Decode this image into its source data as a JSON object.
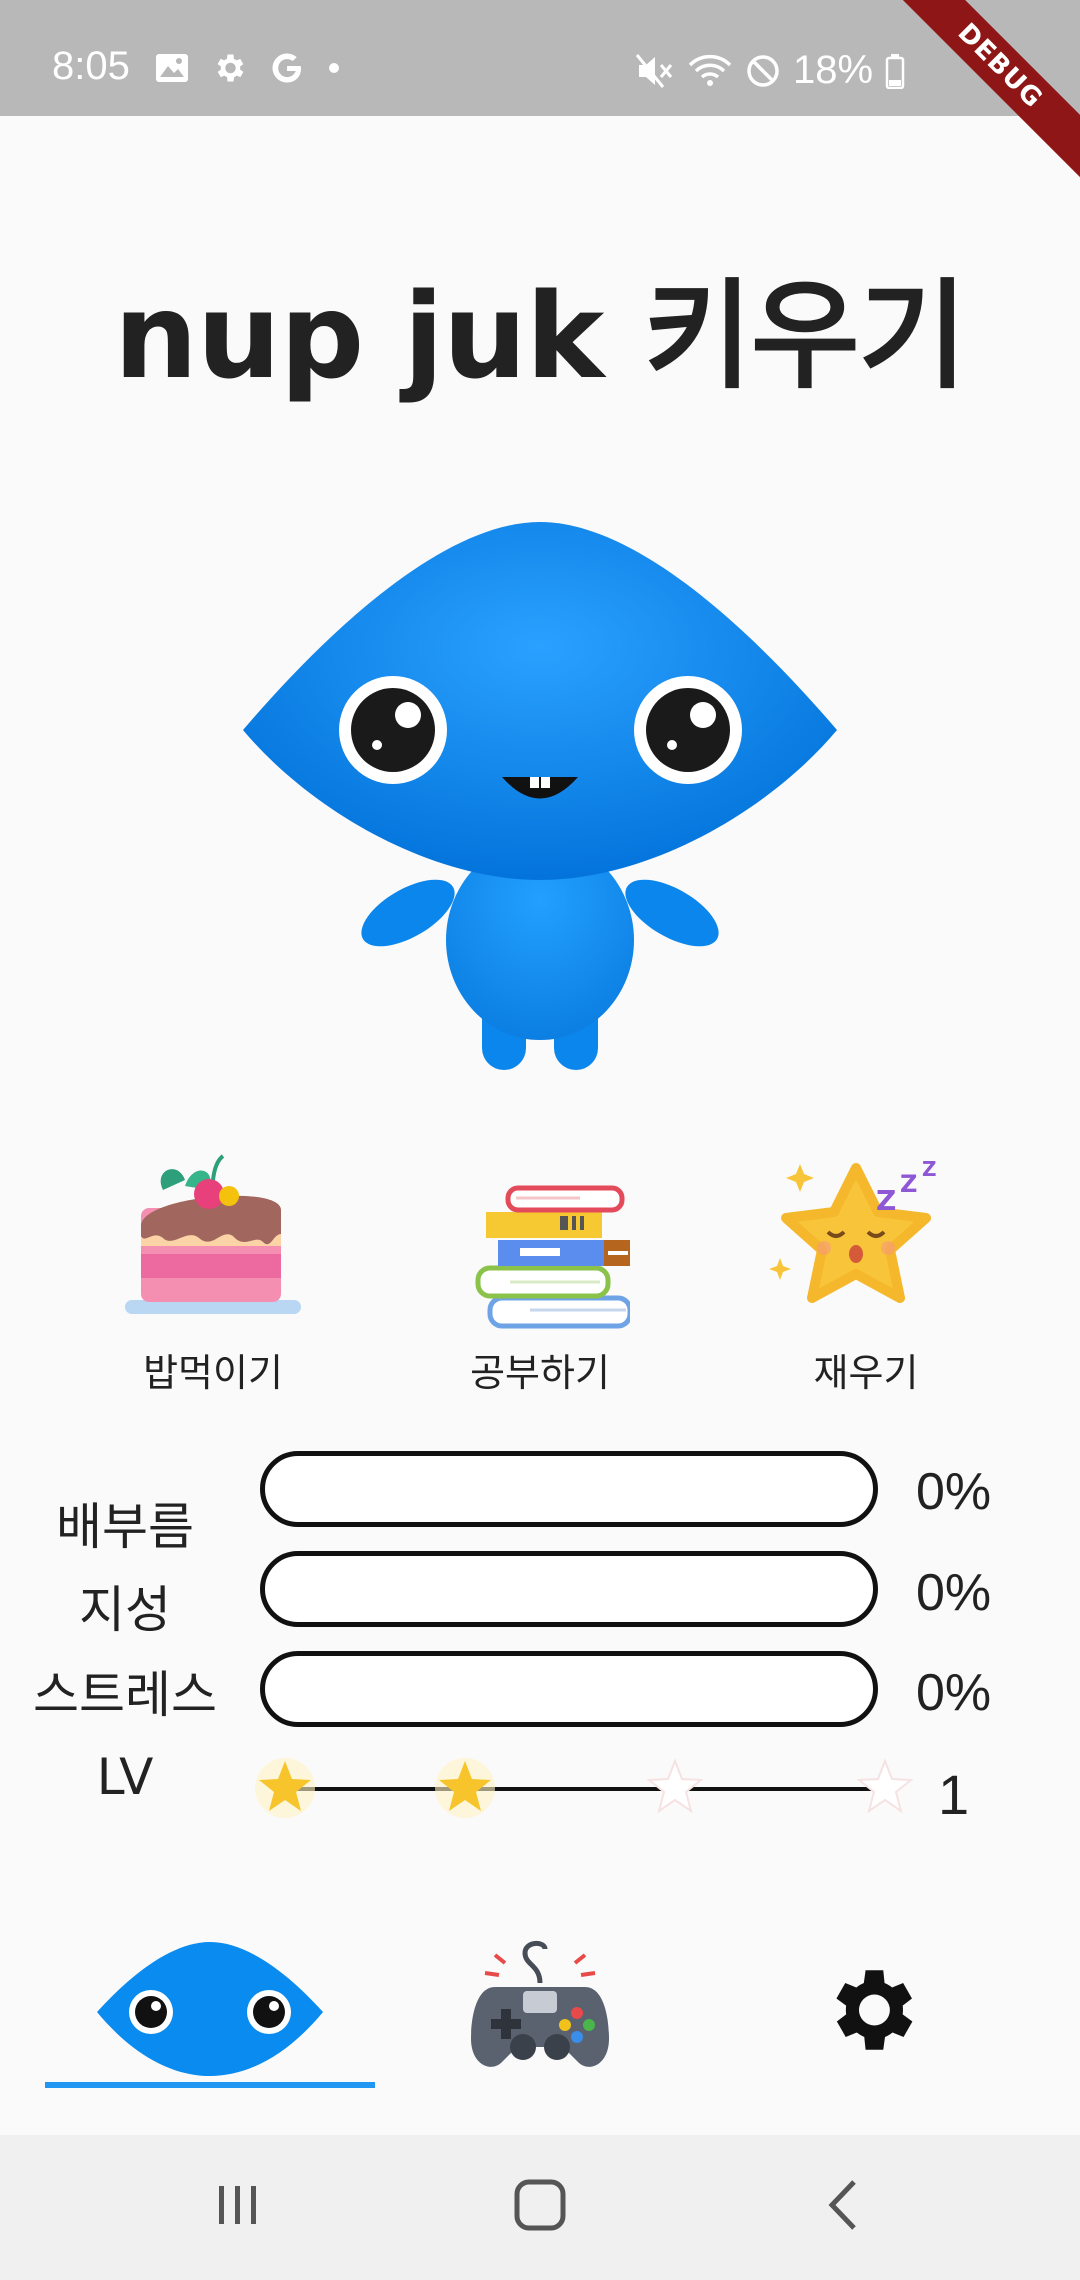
{
  "status_bar": {
    "time": "8:05",
    "battery": "18%",
    "debug_banner": "DEBUG",
    "icons_left": [
      "image-icon",
      "settings-icon",
      "google-icon",
      "dot-icon"
    ],
    "icons_right": [
      "mute-icon",
      "wifi-icon",
      "dnd-icon",
      "battery-icon"
    ]
  },
  "app": {
    "title": "nup juk 키우기"
  },
  "actions": [
    {
      "label": "밥먹이기",
      "icon": "cake-icon"
    },
    {
      "label": "공부하기",
      "icon": "books-icon"
    },
    {
      "label": "재우기",
      "icon": "sleeping-star-icon"
    }
  ],
  "stats": [
    {
      "label": "배부름",
      "value_text": "0%",
      "value": 0
    },
    {
      "label": "지성",
      "value_text": "0%",
      "value": 0
    },
    {
      "label": "스트레스",
      "value_text": "0%",
      "value": 0
    }
  ],
  "level": {
    "label": "LV",
    "value": "1",
    "stars_filled": 2,
    "stars_total": 4
  },
  "bottom_nav": {
    "items": [
      {
        "name": "pet",
        "icon": "nupjuk-face-icon",
        "selected": true
      },
      {
        "name": "game",
        "icon": "gamepad-icon",
        "selected": false
      },
      {
        "name": "settings",
        "icon": "gear-icon",
        "selected": false
      }
    ],
    "accent": "#2196F3"
  },
  "colors": {
    "character": "#0A8BF0",
    "status_bar": "#B8B8B8",
    "debug_ribbon": "#8E1616"
  }
}
